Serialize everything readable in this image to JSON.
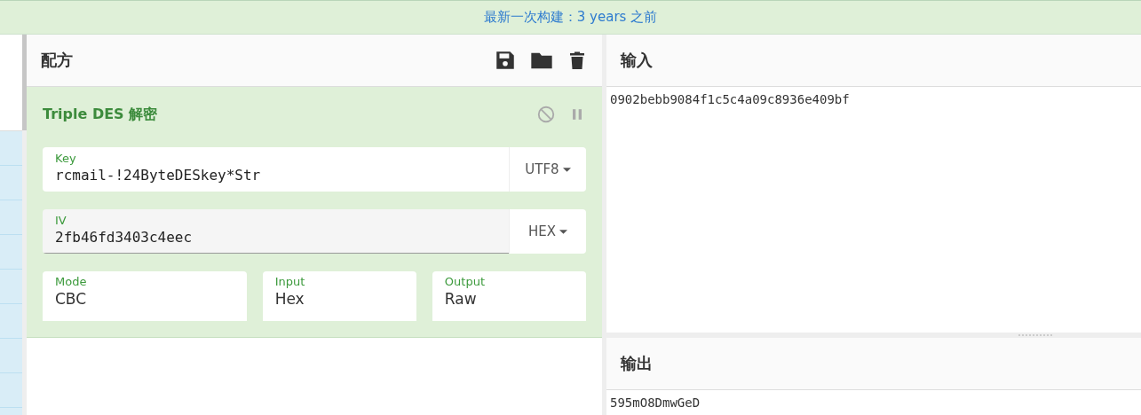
{
  "banner": {
    "text": "最新一次构建：3 years 之前"
  },
  "recipe": {
    "title": "配方",
    "operation": {
      "title": "Triple DES 解密",
      "fields": [
        {
          "kind": "encoded",
          "label": "Key",
          "value": "rcmail-!24ByteDESkey*Str",
          "encoding": "UTF8",
          "focused": false
        },
        {
          "kind": "encoded",
          "label": "IV",
          "value": "2fb46fd3403c4eec",
          "encoding": "HEX",
          "focused": true
        }
      ],
      "options": [
        {
          "label": "Mode",
          "value": "CBC"
        },
        {
          "label": "Input",
          "value": "Hex"
        },
        {
          "label": "Output",
          "value": "Raw"
        }
      ]
    }
  },
  "input": {
    "title": "输入",
    "text": "0902bebb9084f1c5c4a09c8936e409bf"
  },
  "output": {
    "title": "输出",
    "text": "595mO8DmwGeD"
  }
}
